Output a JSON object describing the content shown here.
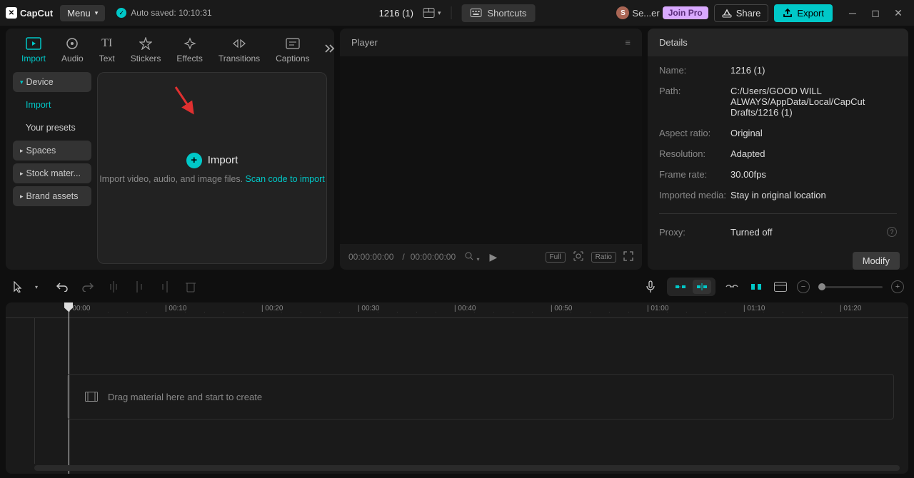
{
  "titlebar": {
    "app_name": "CapCut",
    "menu_label": "Menu",
    "autosave_label": "Auto saved: 10:10:31",
    "project_name": "1216 (1)",
    "shortcuts_label": "Shortcuts",
    "user_initial": "S",
    "user_name": "Se...er",
    "join_pro": "Join Pro",
    "share_label": "Share",
    "export_label": "Export"
  },
  "tabs": {
    "import": "Import",
    "audio": "Audio",
    "text": "Text",
    "stickers": "Stickers",
    "effects": "Effects",
    "transitions": "Transitions",
    "captions": "Captions"
  },
  "sidebar": {
    "device": "Device",
    "import": "Import",
    "presets": "Your presets",
    "spaces": "Spaces",
    "stock": "Stock mater...",
    "brand": "Brand assets"
  },
  "import_area": {
    "title": "Import",
    "desc_prefix": "Import video, audio, and image files. ",
    "scan_link": "Scan code to import"
  },
  "player": {
    "title": "Player",
    "time_current": "00:00:00:00",
    "time_sep": " / ",
    "time_total": "00:00:00:00",
    "full": "Full",
    "ratio": "Ratio"
  },
  "details": {
    "title": "Details",
    "rows": {
      "name_label": "Name:",
      "name_value": "1216 (1)",
      "path_label": "Path:",
      "path_value": "C:/Users/GOOD WILL ALWAYS/AppData/Local/CapCut Drafts/1216 (1)",
      "aspect_label": "Aspect ratio:",
      "aspect_value": "Original",
      "resolution_label": "Resolution:",
      "resolution_value": "Adapted",
      "framerate_label": "Frame rate:",
      "framerate_value": "30.00fps",
      "imported_label": "Imported media:",
      "imported_value": "Stay in original location",
      "proxy_label": "Proxy:",
      "proxy_value": "Turned off"
    },
    "modify": "Modify"
  },
  "timeline": {
    "placeholder": "Drag material here and start to create",
    "ticks": [
      "00:00",
      "00:10",
      "00:20",
      "00:30",
      "00:40",
      "00:50",
      "01:00",
      "01:10",
      "01:20"
    ]
  }
}
